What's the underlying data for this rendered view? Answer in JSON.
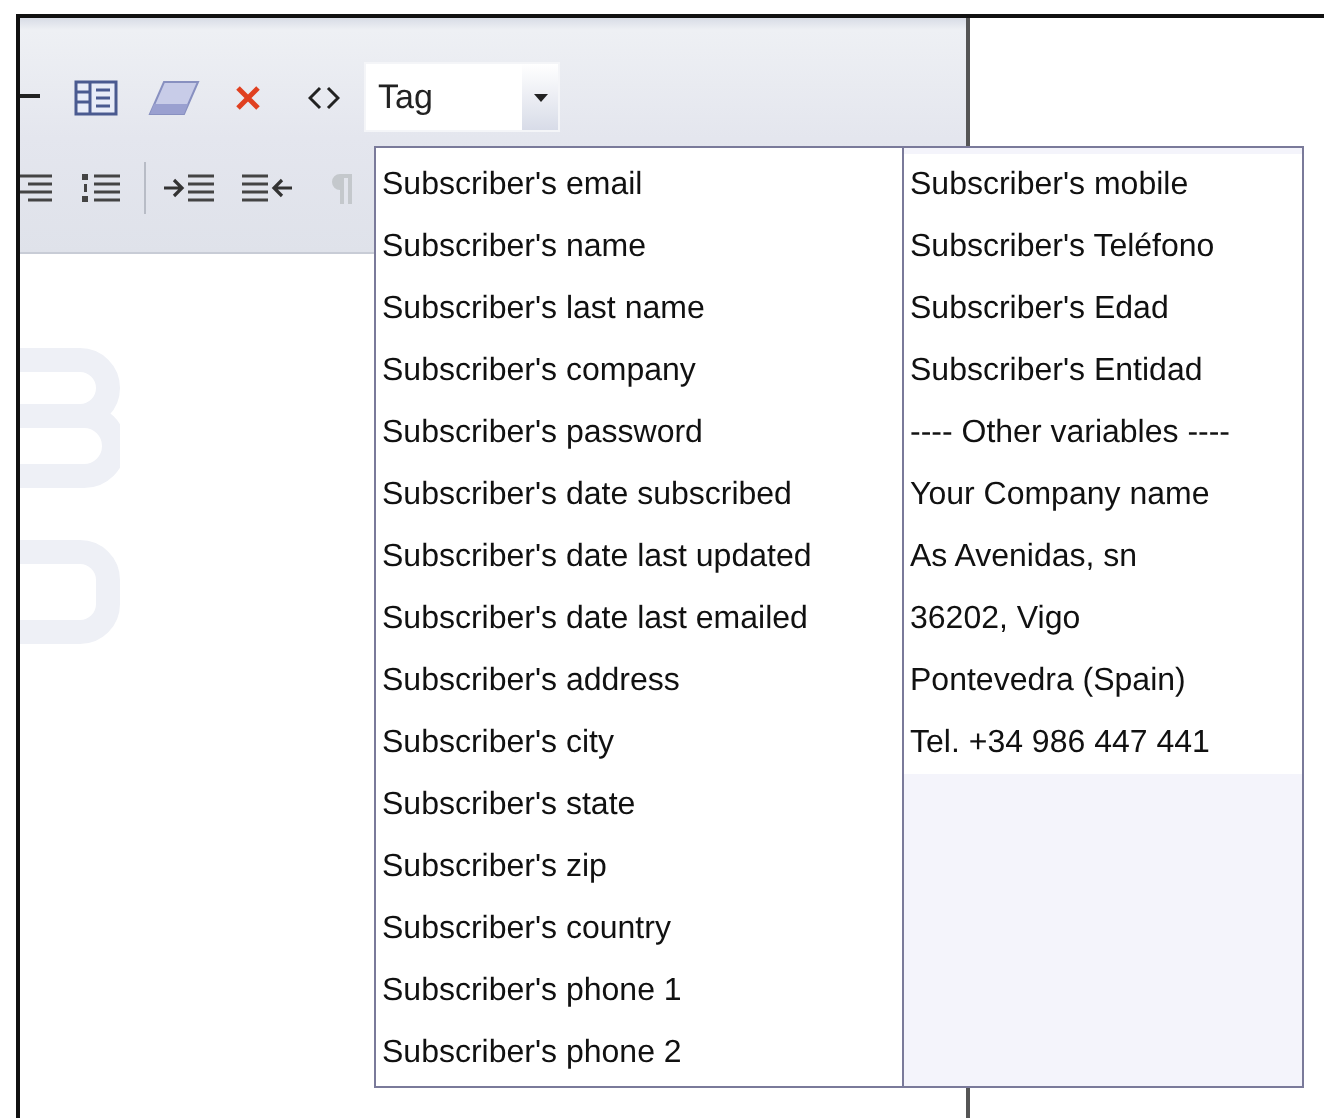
{
  "toolbar": {
    "tag_select": {
      "value": "Tag"
    }
  },
  "tag_menu": {
    "columns": [
      {
        "items": [
          "Subscriber's email",
          "Subscriber's name",
          "Subscriber's last name",
          "Subscriber's company",
          "Subscriber's password",
          "Subscriber's date subscribed",
          "Subscriber's date last updated",
          "Subscriber's date last emailed",
          "Subscriber's address",
          "Subscriber's city",
          "Subscriber's state",
          "Subscriber's zip",
          "Subscriber's country",
          "Subscriber's phone 1",
          "Subscriber's phone 2"
        ]
      },
      {
        "items": [
          "Subscriber's mobile",
          "Subscriber's Teléfono",
          "Subscriber's Edad",
          "Subscriber's Entidad",
          "---- Other variables ----",
          "Your Company name",
          "As Avenidas, sn",
          "36202, Vigo",
          "Pontevedra (Spain)",
          "Tel. +34 986 447 441"
        ]
      }
    ]
  }
}
